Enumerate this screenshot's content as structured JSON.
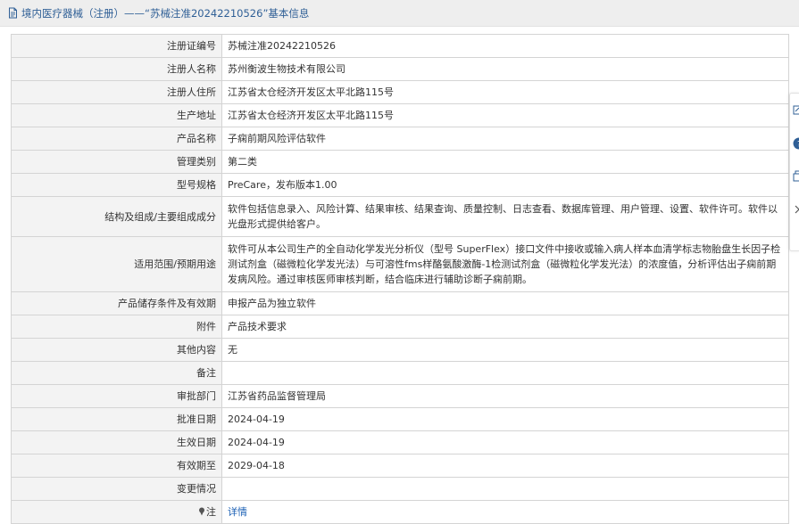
{
  "header": {
    "title": "境内医疗器械（注册）——“苏械注准20242210526”基本信息",
    "icon": "document-icon",
    "color": "#2f5f96"
  },
  "table": {
    "rows": [
      {
        "label": "注册证编号",
        "value": "苏械注准20242210526"
      },
      {
        "label": "注册人名称",
        "value": "苏州衡波生物技术有限公司"
      },
      {
        "label": "注册人住所",
        "value": "江苏省太仓经济开发区太平北路115号"
      },
      {
        "label": "生产地址",
        "value": "江苏省太仓经济开发区太平北路115号"
      },
      {
        "label": "产品名称",
        "value": "子痫前期风险评估软件"
      },
      {
        "label": "管理类别",
        "value": "第二类"
      },
      {
        "label": "型号规格",
        "value": "PreCare，发布版本1.00"
      },
      {
        "label": "结构及组成/主要组成成分",
        "value": "软件包括信息录入、风险计算、结果审核、结果查询、质量控制、日志查看、数据库管理、用户管理、设置、软件许可。软件以光盘形式提供给客户。"
      },
      {
        "label": "适用范围/预期用途",
        "value": "软件可从本公司生产的全自动化学发光分析仪（型号 SuperFlex）接口文件中接收或输入病人样本血清学标志物胎盘生长因子检测试剂盒（磁微粒化学发光法）与可溶性fms样酪氨酸激酶-1检测试剂盒（磁微粒化学发光法）的浓度值，分析评估出子痫前期发病风险。通过审核医师审核判断，结合临床进行辅助诊断子痫前期。"
      },
      {
        "label": "产品储存条件及有效期",
        "value": "申报产品为独立软件"
      },
      {
        "label": "附件",
        "value": "产品技术要求"
      },
      {
        "label": "其他内容",
        "value": "无"
      },
      {
        "label": "备注",
        "value": ""
      },
      {
        "label": "审批部门",
        "value": "江苏省药品监督管理局"
      },
      {
        "label": "批准日期",
        "value": "2024-04-19"
      },
      {
        "label": "生效日期",
        "value": "2024-04-19"
      },
      {
        "label": "有效期至",
        "value": "2029-04-18"
      },
      {
        "label": "变更情况",
        "value": ""
      }
    ],
    "note": {
      "label": "注",
      "icon": "pin-icon",
      "link_text": "详情"
    }
  },
  "side_toolbar": {
    "icons": [
      "edit-icon",
      "help-icon",
      "copy-icon",
      "chevron-right-icon"
    ]
  },
  "colors": {
    "link": "#1a5fb4",
    "label_bg": "#f3f3f3",
    "border": "#d4d4d4"
  }
}
